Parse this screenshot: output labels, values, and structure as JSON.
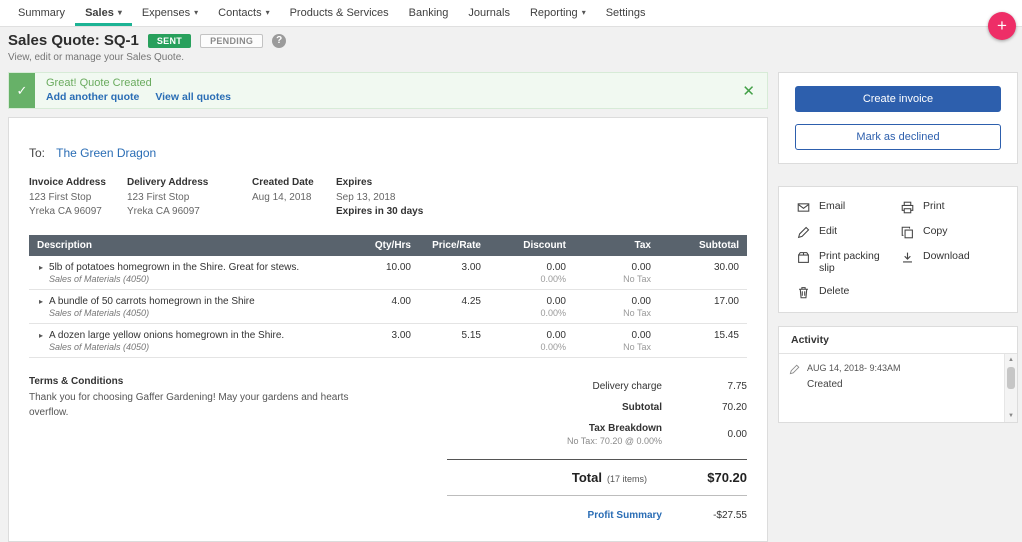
{
  "icons": {
    "plus": "+",
    "caret": "▾",
    "check": "✓",
    "close": "✕",
    "help": "?",
    "row_expand": "▸",
    "scroll_up": "▲",
    "scroll_down": "▼"
  },
  "colors": {
    "accent_teal": "#1cb394",
    "brand_pink": "#ee2e67",
    "success_green": "#28a05c",
    "link_blue": "#2a6db5",
    "primary_blue": "#2d5fad",
    "table_header_gray": "#59636d"
  },
  "nav": {
    "items": [
      {
        "label": "Summary",
        "dropdown": false
      },
      {
        "label": "Sales",
        "dropdown": true
      },
      {
        "label": "Expenses",
        "dropdown": true
      },
      {
        "label": "Contacts",
        "dropdown": true
      },
      {
        "label": "Products & Services",
        "dropdown": false
      },
      {
        "label": "Banking",
        "dropdown": false
      },
      {
        "label": "Journals",
        "dropdown": false
      },
      {
        "label": "Reporting",
        "dropdown": true
      },
      {
        "label": "Settings",
        "dropdown": false
      }
    ]
  },
  "header": {
    "title": "Sales Quote: SQ-1",
    "status_sent": "SENT",
    "status_pending": "PENDING",
    "subtitle": "View, edit or manage your Sales Quote."
  },
  "banner": {
    "message": "Great! Quote Created",
    "link_add_another": "Add another quote",
    "link_view_all": "View all quotes"
  },
  "quote": {
    "to_label": "To:",
    "customer": "The Green Dragon",
    "invoice_address": {
      "label": "Invoice Address",
      "line1": "123 First Stop",
      "line2": "Yreka CA 96097"
    },
    "delivery_address": {
      "label": "Delivery Address",
      "line1": "123 First Stop",
      "line2": "Yreka CA 96097"
    },
    "created": {
      "label": "Created Date",
      "value": "Aug 14, 2018"
    },
    "expires": {
      "label": "Expires",
      "value": "Sep 13, 2018",
      "note": "Expires in 30 days"
    },
    "table": {
      "headers": {
        "description": "Description",
        "qty": "Qty/Hrs",
        "price": "Price/Rate",
        "discount": "Discount",
        "tax": "Tax",
        "subtotal": "Subtotal"
      },
      "rows": [
        {
          "description": "5lb of potatoes homegrown in the Shire. Great for stews.",
          "account": "Sales of Materials (4050)",
          "qty": "10.00",
          "price": "3.00",
          "discount": "0.00",
          "discount_pct": "0.00%",
          "tax": "0.00",
          "tax_code": "No Tax",
          "subtotal": "30.00"
        },
        {
          "description": "A bundle of 50 carrots homegrown in the Shire",
          "account": "Sales of Materials (4050)",
          "qty": "4.00",
          "price": "4.25",
          "discount": "0.00",
          "discount_pct": "0.00%",
          "tax": "0.00",
          "tax_code": "No Tax",
          "subtotal": "17.00"
        },
        {
          "description": "A dozen large yellow onions homegrown in the Shire.",
          "account": "Sales of Materials (4050)",
          "qty": "3.00",
          "price": "5.15",
          "discount": "0.00",
          "discount_pct": "0.00%",
          "tax": "0.00",
          "tax_code": "No Tax",
          "subtotal": "15.45"
        }
      ]
    },
    "terms": {
      "title": "Terms & Conditions",
      "text": "Thank you for choosing Gaffer Gardening! May your gardens and hearts overflow."
    },
    "totals": {
      "delivery_label": "Delivery charge",
      "delivery_value": "7.75",
      "subtotal_label": "Subtotal",
      "subtotal_value": "70.20",
      "tax_breakdown_label": "Tax Breakdown",
      "tax_breakdown_detail": "No Tax: 70.20 @ 0.00%",
      "tax_breakdown_value": "0.00",
      "total_label": "Total",
      "total_items": "(17 items)",
      "total_value": "$70.20",
      "profit_label": "Profit Summary",
      "profit_value": "-$27.55"
    }
  },
  "sidebar": {
    "create_invoice_label": "Create invoice",
    "mark_declined_label": "Mark as declined",
    "actions": [
      {
        "icon": "email-icon",
        "label": "Email"
      },
      {
        "icon": "print-icon",
        "label": "Print"
      },
      {
        "icon": "edit-icon",
        "label": "Edit"
      },
      {
        "icon": "copy-icon",
        "label": "Copy"
      },
      {
        "icon": "packing-slip-icon",
        "label": "Print packing slip"
      },
      {
        "icon": "download-icon",
        "label": "Download"
      },
      {
        "icon": "delete-icon",
        "label": "Delete"
      }
    ],
    "activity": {
      "title": "Activity",
      "entries": [
        {
          "date": "AUG 14, 2018- 9:43AM",
          "action": "Created"
        }
      ]
    }
  }
}
